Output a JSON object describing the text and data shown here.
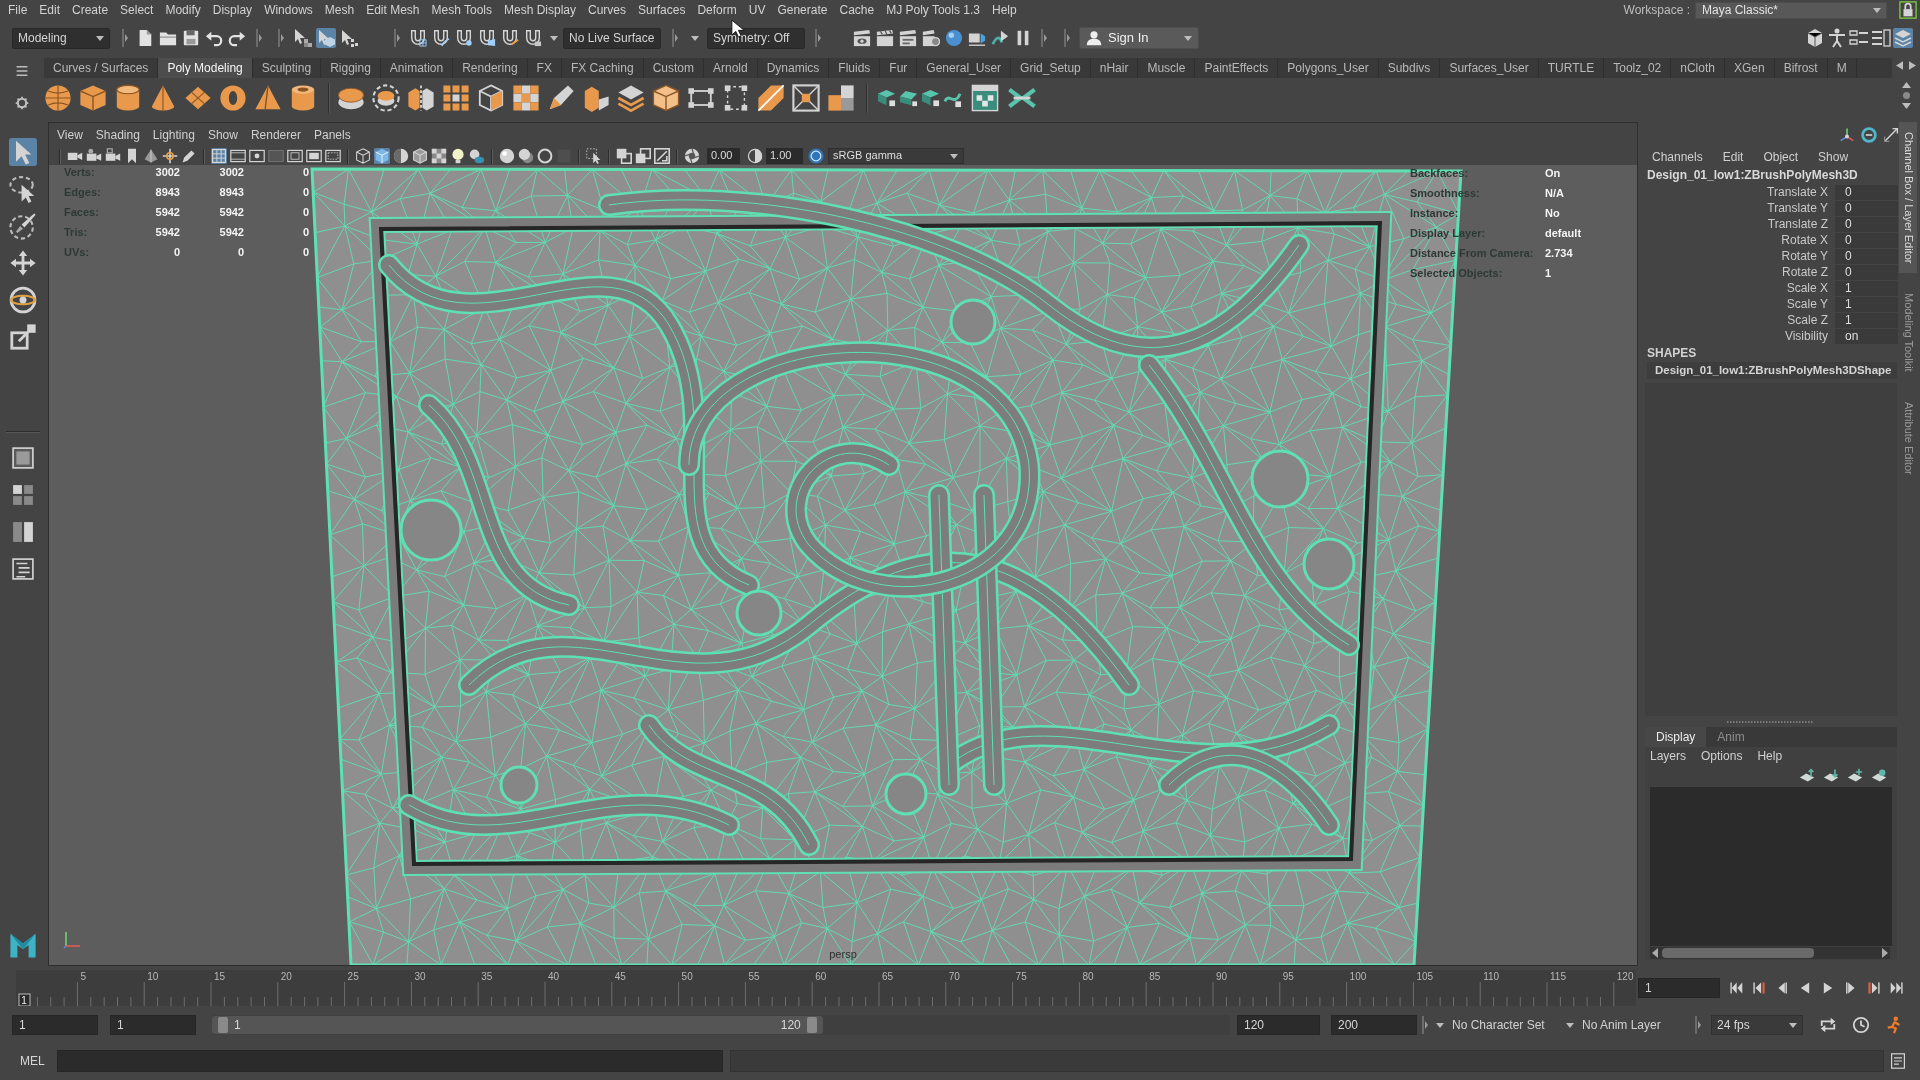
{
  "menu_bar": {
    "items": [
      "File",
      "Edit",
      "Create",
      "Select",
      "Modify",
      "Display",
      "Windows",
      "Mesh",
      "Edit Mesh",
      "Mesh Tools",
      "Mesh Display",
      "Curves",
      "Surfaces",
      "Deform",
      "UV",
      "Generate",
      "Cache",
      "MJ Poly Tools 1.3",
      "Help"
    ],
    "workspace_label": "Workspace :",
    "workspace": "Maya Classic*"
  },
  "status_line": {
    "menu_set": "Modeling",
    "select_modes": [
      {
        "selected": false
      },
      {
        "selected": true
      },
      {
        "selected": false
      }
    ],
    "live_surface": "No Live Surface",
    "symmetry": "Symmetry: Off",
    "sign_in": "Sign In",
    "panel_toggles": [
      {
        "on": false
      },
      {
        "on": false
      },
      {
        "on": false
      },
      {
        "on": false
      },
      {
        "on": true
      }
    ]
  },
  "shelf": {
    "tabs": [
      {
        "label": "Curves / Surfaces",
        "selected": false
      },
      {
        "label": "Poly Modeling",
        "selected": true
      },
      {
        "label": "Sculpting",
        "selected": false
      },
      {
        "label": "Rigging",
        "selected": false
      },
      {
        "label": "Animation",
        "selected": false
      },
      {
        "label": "Rendering",
        "selected": false
      },
      {
        "label": "FX",
        "selected": false
      },
      {
        "label": "FX Caching",
        "selected": false
      },
      {
        "label": "Custom",
        "selected": false
      },
      {
        "label": "Arnold",
        "selected": false
      },
      {
        "label": "Dynamics",
        "selected": false
      },
      {
        "label": "Fluids",
        "selected": false
      },
      {
        "label": "Fur",
        "selected": false
      },
      {
        "label": "General_User",
        "selected": false
      },
      {
        "label": "Grid_Setup",
        "selected": false
      },
      {
        "label": "nHair",
        "selected": false
      },
      {
        "label": "Muscle",
        "selected": false
      },
      {
        "label": "PaintEffects",
        "selected": false
      },
      {
        "label": "Polygons_User",
        "selected": false
      },
      {
        "label": "Subdivs",
        "selected": false
      },
      {
        "label": "Surfaces_User",
        "selected": false
      },
      {
        "label": "TURTLE",
        "selected": false
      },
      {
        "label": "Toolz_02",
        "selected": false
      },
      {
        "label": "nCloth",
        "selected": false
      },
      {
        "label": "XGen",
        "selected": false
      },
      {
        "label": "Bifrost",
        "selected": false
      },
      {
        "label": "M",
        "selected": false
      }
    ]
  },
  "toolbox": {
    "tools": [
      {
        "selected": true
      },
      {
        "selected": false
      },
      {
        "selected": false
      },
      {
        "selected": false
      },
      {
        "selected": false
      },
      {
        "selected": false
      }
    ]
  },
  "viewport": {
    "menu": [
      "View",
      "Shading",
      "Lighting",
      "Show",
      "Renderer",
      "Panels"
    ],
    "view_toggles": [
      {
        "on": true
      },
      {
        "on": false
      },
      {
        "on": false
      },
      {
        "on": false
      },
      {
        "on": false
      },
      {
        "on": false
      },
      {
        "on": false
      }
    ],
    "shading_toggles": [
      {
        "on": false
      },
      {
        "on": true
      },
      {
        "on": false
      },
      {
        "on": false
      },
      {
        "on": false
      },
      {
        "on": false
      },
      {
        "on": false
      }
    ],
    "exposure": "0.00",
    "gamma": "1.00",
    "color_management": {
      "on": true
    },
    "color_space": "sRGB gamma",
    "hud_stats": [
      {
        "label": "Verts:",
        "values": [
          "3002",
          "3002",
          "0"
        ]
      },
      {
        "label": "Edges:",
        "values": [
          "8943",
          "8943",
          "0"
        ]
      },
      {
        "label": "Faces:",
        "values": [
          "5942",
          "5942",
          "0"
        ]
      },
      {
        "label": "Tris:",
        "values": [
          "5942",
          "5942",
          "0"
        ]
      },
      {
        "label": "UVs:",
        "values": [
          "0",
          "0",
          "0"
        ]
      }
    ],
    "hud_info": [
      {
        "label": "Backfaces:",
        "value": "On"
      },
      {
        "label": "Smoothness:",
        "value": "N/A"
      },
      {
        "label": "Instance:",
        "value": "No"
      },
      {
        "label": "Display Layer:",
        "value": "default"
      },
      {
        "label": "Distance From Camera:",
        "value": "2.734"
      },
      {
        "label": "Selected Objects:",
        "value": "1"
      }
    ],
    "camera": "persp"
  },
  "channel_box": {
    "menu": [
      "Channels",
      "Edit",
      "Object",
      "Show"
    ],
    "object": "Design_01_low1:ZBrushPolyMesh3D",
    "channels": [
      {
        "name": "Translate X",
        "value": "0"
      },
      {
        "name": "Translate Y",
        "value": "0"
      },
      {
        "name": "Translate Z",
        "value": "0"
      },
      {
        "name": "Rotate X",
        "value": "0"
      },
      {
        "name": "Rotate Y",
        "value": "0"
      },
      {
        "name": "Rotate Z",
        "value": "0"
      },
      {
        "name": "Scale X",
        "value": "1"
      },
      {
        "name": "Scale Y",
        "value": "1"
      },
      {
        "name": "Scale Z",
        "value": "1"
      },
      {
        "name": "Visibility",
        "value": "on"
      }
    ],
    "shapes_heading": "SHAPES",
    "shape": "Design_01_low1:ZBrushPolyMesh3DShape"
  },
  "layer_editor": {
    "tabs": [
      {
        "label": "Display",
        "selected": true
      },
      {
        "label": "Anim",
        "selected": false
      }
    ],
    "menu": [
      "Layers",
      "Options",
      "Help"
    ]
  },
  "side_tabs": [
    {
      "label": "Channel Box / Layer Editor",
      "selected": true
    },
    {
      "label": "Modeling Toolkit",
      "selected": false
    },
    {
      "label": "Attribute Editor",
      "selected": false
    }
  ],
  "time_slider": {
    "ticks": [
      "5",
      "10",
      "15",
      "20",
      "25",
      "30",
      "35",
      "40",
      "45",
      "50",
      "55",
      "60",
      "65",
      "70",
      "75",
      "80",
      "85",
      "90",
      "95",
      "100",
      "105",
      "110",
      "115",
      "120"
    ],
    "current_frame": "1",
    "level": 0,
    "frame_field": "1"
  },
  "range_slider": {
    "start_time": "1",
    "playback_start": "1",
    "level": 0.6,
    "range_start": "1",
    "range_end": "120",
    "playback_end": "120",
    "end_time": "200",
    "character_set": "No Character Set",
    "anim_layer": "No Anim Layer",
    "fps": "24 fps"
  },
  "command_line": {
    "language": "MEL"
  }
}
